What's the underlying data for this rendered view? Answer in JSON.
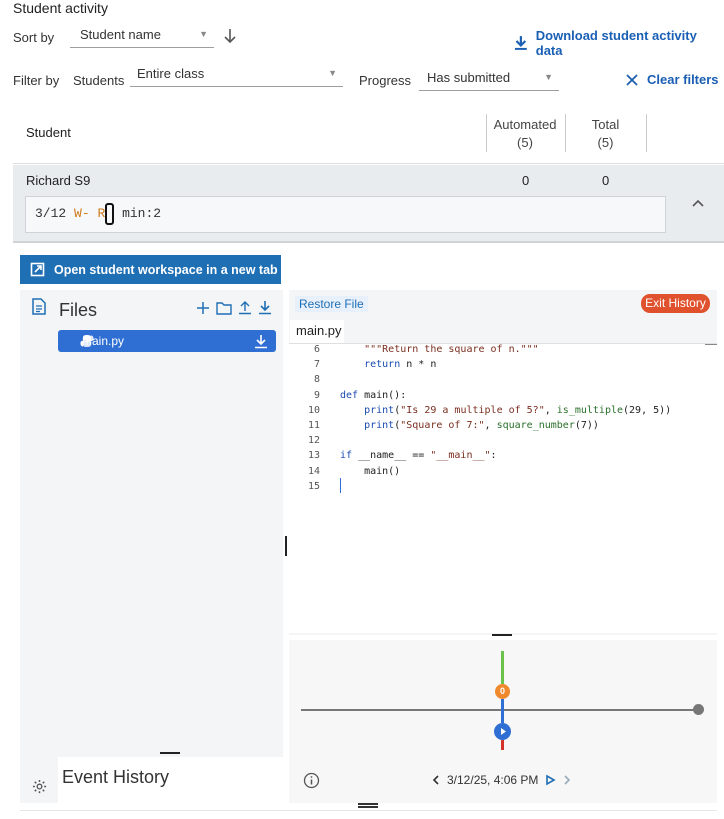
{
  "header": {
    "title": "Student activity",
    "sort_label": "Sort by",
    "sort_value": "Student name",
    "download_label": "Download student activity data",
    "filter_label": "Filter by",
    "students_label": "Students",
    "students_value": "Entire class",
    "progress_label": "Progress",
    "progress_value": "Has submitted",
    "clear_label": "Clear filters"
  },
  "table": {
    "col_student": "Student",
    "col_automated": "Automated",
    "col_automated_count": "(5)",
    "col_total": "Total",
    "col_total_count": "(5)",
    "row": {
      "name": "Richard S9",
      "automated": "0",
      "total": "0",
      "summary_date": "3/12",
      "summary_w": "W-",
      "summary_r": "R",
      "summary_min": "min:2"
    }
  },
  "workspace": {
    "open_button": "Open student workspace in a new tab",
    "files_title": "Files",
    "file_name": "main.py",
    "event_history": "Event History",
    "restore_label": "Restore File",
    "exit_label": "Exit History",
    "tab_name": "main.py",
    "timeline_date": "3/12/25, 4:06 PM",
    "marker_label": "0"
  },
  "code": {
    "lines": [
      {
        "n": "6",
        "t": "    \"\"\"Return the square of n.\"\"\""
      },
      {
        "n": "7",
        "t": "    return n * n"
      },
      {
        "n": "8",
        "t": ""
      },
      {
        "n": "9",
        "t": "def main():"
      },
      {
        "n": "10",
        "t": "    print(\"Is 29 a multiple of 5?\", is_multiple(29, 5))"
      },
      {
        "n": "11",
        "t": "    print(\"Square of 7:\", square_number(7))"
      },
      {
        "n": "12",
        "t": ""
      },
      {
        "n": "13",
        "t": "if __name__ == \"__main__\":"
      },
      {
        "n": "14",
        "t": "    main()"
      },
      {
        "n": "15",
        "t": ""
      }
    ]
  },
  "colors": {
    "accent": "#1f6fb5",
    "exit": "#e0522d",
    "file_item": "#2f6fd3",
    "marker_orange": "#f0882d",
    "marker_blue": "#2f6fd3"
  },
  "icons": [
    "sort-arrow-down-icon",
    "download-icon",
    "close-icon",
    "chevron-up-icon",
    "open-external-icon",
    "file-doc-icon",
    "plus-icon",
    "folder-icon",
    "upload-icon",
    "python-icon",
    "gear-icon",
    "info-icon",
    "chevron-left-icon",
    "play-icon",
    "chevron-right-icon"
  ]
}
